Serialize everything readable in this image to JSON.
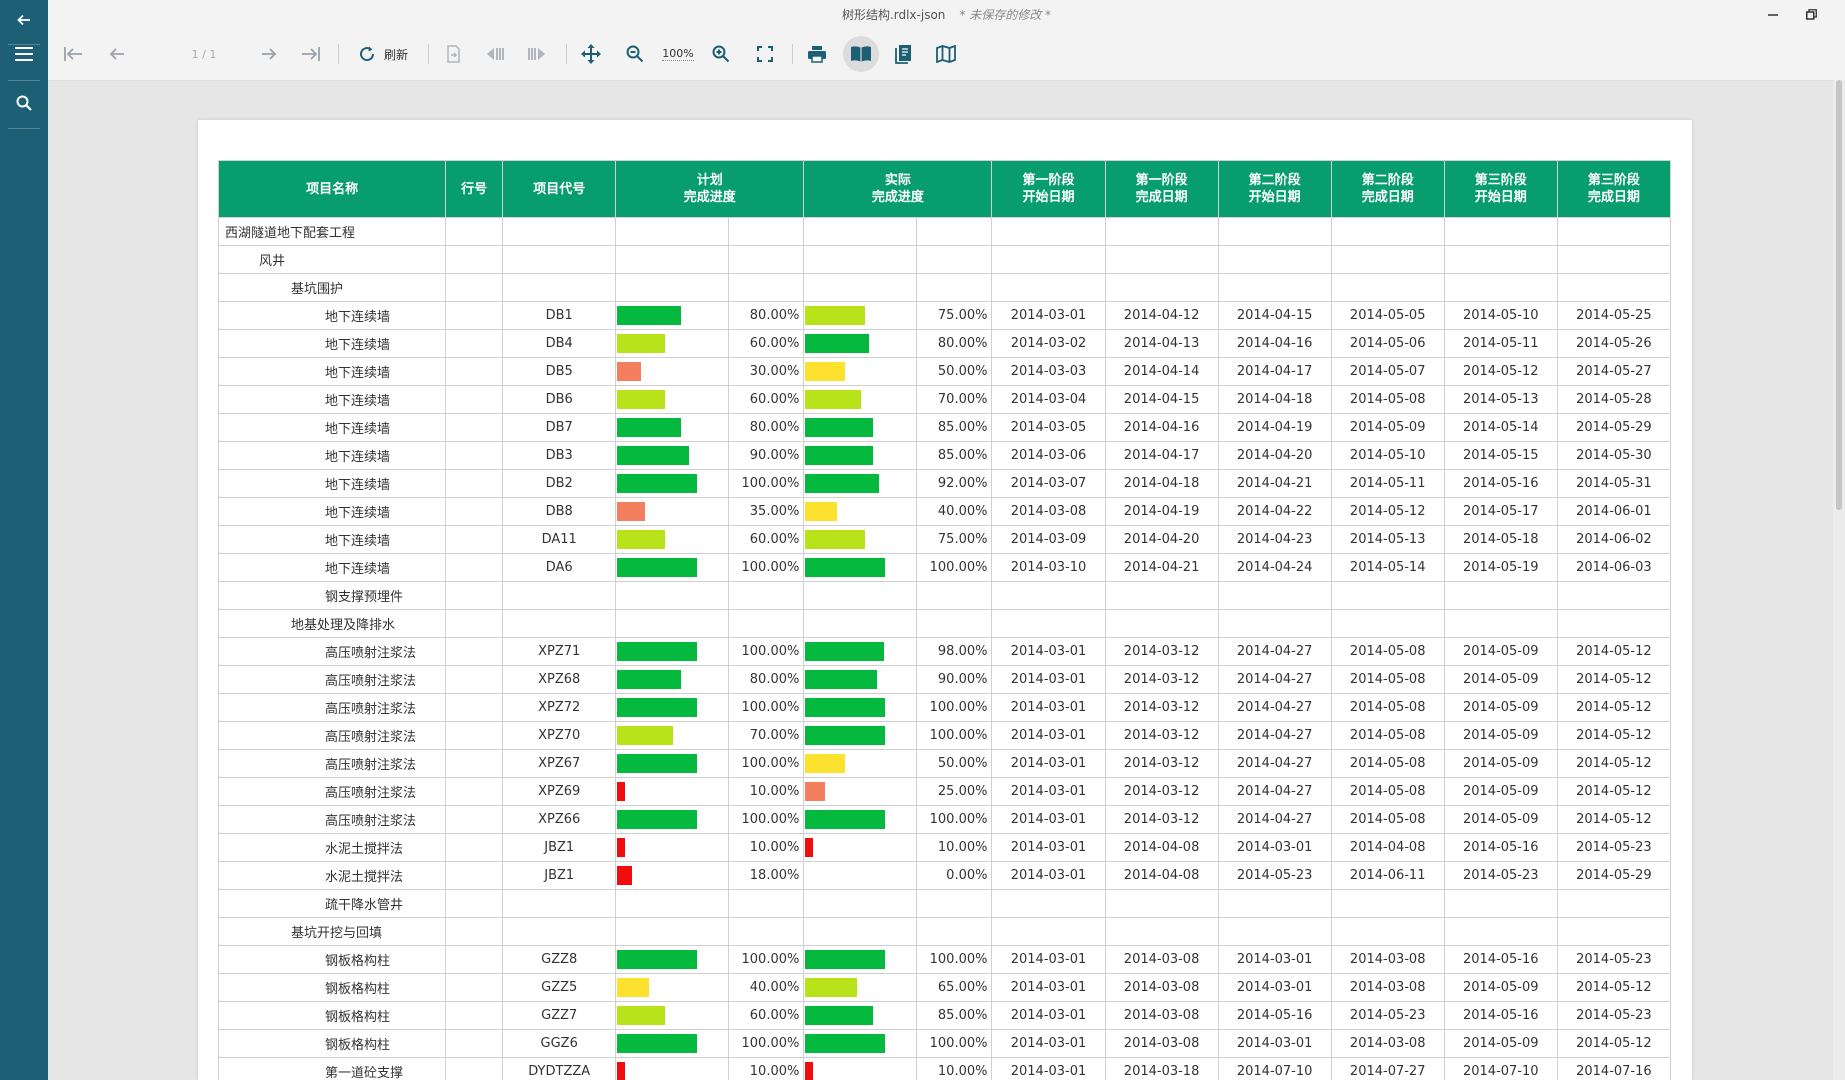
{
  "window": {
    "title": "树形结构.rdlx-json",
    "unsaved": "* 未保存的修改 *"
  },
  "toolbar": {
    "page_indicator": "1 / 1",
    "refresh_label": "刷新",
    "zoom_label": "100%"
  },
  "colors": {
    "sidebar": "#1d5f74",
    "header": "#079d6c",
    "bar_green": "#05b83e",
    "bar_lime": "#b8e31b",
    "bar_yellow": "#fde12f",
    "bar_orange": "#f37f5f",
    "bar_red": "#f10d0d"
  },
  "table": {
    "headers": [
      "项目名称",
      "行号",
      "项目代号",
      "计划\n完成进度",
      "",
      "实际\n完成进度",
      "",
      "第一阶段\n开始日期",
      "第一阶段\n完成日期",
      "第二阶段\n开始日期",
      "第二阶段\n完成日期",
      "第三阶段\n开始日期",
      "第三阶段\n完成日期"
    ],
    "rows": [
      {
        "name": "西湖隧道地下配套工程",
        "level": 0
      },
      {
        "name": "风井",
        "level": 1
      },
      {
        "name": "基坑围护",
        "level": 2
      },
      {
        "name": "地下连续墙",
        "level": 3,
        "code": "DB1",
        "plan": 80,
        "plan_text": "80.00%",
        "actual": 75,
        "actual_text": "75.00%",
        "dates": [
          "2014-03-01",
          "2014-04-12",
          "2014-04-15",
          "2014-05-05",
          "2014-05-10",
          "2014-05-25"
        ]
      },
      {
        "name": "地下连续墙",
        "level": 3,
        "code": "DB4",
        "plan": 60,
        "plan_text": "60.00%",
        "actual": 80,
        "actual_text": "80.00%",
        "dates": [
          "2014-03-02",
          "2014-04-13",
          "2014-04-16",
          "2014-05-06",
          "2014-05-11",
          "2014-05-26"
        ]
      },
      {
        "name": "地下连续墙",
        "level": 3,
        "code": "DB5",
        "plan": 30,
        "plan_text": "30.00%",
        "actual": 50,
        "actual_text": "50.00%",
        "dates": [
          "2014-03-03",
          "2014-04-14",
          "2014-04-17",
          "2014-05-07",
          "2014-05-12",
          "2014-05-27"
        ]
      },
      {
        "name": "地下连续墙",
        "level": 3,
        "code": "DB6",
        "plan": 60,
        "plan_text": "60.00%",
        "actual": 70,
        "actual_text": "70.00%",
        "dates": [
          "2014-03-04",
          "2014-04-15",
          "2014-04-18",
          "2014-05-08",
          "2014-05-13",
          "2014-05-28"
        ]
      },
      {
        "name": "地下连续墙",
        "level": 3,
        "code": "DB7",
        "plan": 80,
        "plan_text": "80.00%",
        "actual": 85,
        "actual_text": "85.00%",
        "dates": [
          "2014-03-05",
          "2014-04-16",
          "2014-04-19",
          "2014-05-09",
          "2014-05-14",
          "2014-05-29"
        ]
      },
      {
        "name": "地下连续墙",
        "level": 3,
        "code": "DB3",
        "plan": 90,
        "plan_text": "90.00%",
        "actual": 85,
        "actual_text": "85.00%",
        "dates": [
          "2014-03-06",
          "2014-04-17",
          "2014-04-20",
          "2014-05-10",
          "2014-05-15",
          "2014-05-30"
        ]
      },
      {
        "name": "地下连续墙",
        "level": 3,
        "code": "DB2",
        "plan": 100,
        "plan_text": "100.00%",
        "actual": 92,
        "actual_text": "92.00%",
        "dates": [
          "2014-03-07",
          "2014-04-18",
          "2014-04-21",
          "2014-05-11",
          "2014-05-16",
          "2014-05-31"
        ]
      },
      {
        "name": "地下连续墙",
        "level": 3,
        "code": "DB8",
        "plan": 35,
        "plan_text": "35.00%",
        "actual": 40,
        "actual_text": "40.00%",
        "dates": [
          "2014-03-08",
          "2014-04-19",
          "2014-04-22",
          "2014-05-12",
          "2014-05-17",
          "2014-06-01"
        ]
      },
      {
        "name": "地下连续墙",
        "level": 3,
        "code": "DA11",
        "plan": 60,
        "plan_text": "60.00%",
        "actual": 75,
        "actual_text": "75.00%",
        "dates": [
          "2014-03-09",
          "2014-04-20",
          "2014-04-23",
          "2014-05-13",
          "2014-05-18",
          "2014-06-02"
        ]
      },
      {
        "name": "地下连续墙",
        "level": 3,
        "code": "DA6",
        "plan": 100,
        "plan_text": "100.00%",
        "actual": 100,
        "actual_text": "100.00%",
        "dates": [
          "2014-03-10",
          "2014-04-21",
          "2014-04-24",
          "2014-05-14",
          "2014-05-19",
          "2014-06-03"
        ]
      },
      {
        "name": "钢支撑预埋件",
        "level": 3
      },
      {
        "name": "地基处理及降排水",
        "level": 2
      },
      {
        "name": "高压喷射注浆法",
        "level": 3,
        "code": "XPZ71",
        "plan": 100,
        "plan_text": "100.00%",
        "actual": 98,
        "actual_text": "98.00%",
        "dates": [
          "2014-03-01",
          "2014-03-12",
          "2014-04-27",
          "2014-05-08",
          "2014-05-09",
          "2014-05-12"
        ]
      },
      {
        "name": "高压喷射注浆法",
        "level": 3,
        "code": "XPZ68",
        "plan": 80,
        "plan_text": "80.00%",
        "actual": 90,
        "actual_text": "90.00%",
        "dates": [
          "2014-03-01",
          "2014-03-12",
          "2014-04-27",
          "2014-05-08",
          "2014-05-09",
          "2014-05-12"
        ]
      },
      {
        "name": "高压喷射注浆法",
        "level": 3,
        "code": "XPZ72",
        "plan": 100,
        "plan_text": "100.00%",
        "actual": 100,
        "actual_text": "100.00%",
        "dates": [
          "2014-03-01",
          "2014-03-12",
          "2014-04-27",
          "2014-05-08",
          "2014-05-09",
          "2014-05-12"
        ]
      },
      {
        "name": "高压喷射注浆法",
        "level": 3,
        "code": "XPZ70",
        "plan": 70,
        "plan_text": "70.00%",
        "actual": 100,
        "actual_text": "100.00%",
        "dates": [
          "2014-03-01",
          "2014-03-12",
          "2014-04-27",
          "2014-05-08",
          "2014-05-09",
          "2014-05-12"
        ]
      },
      {
        "name": "高压喷射注浆法",
        "level": 3,
        "code": "XPZ67",
        "plan": 100,
        "plan_text": "100.00%",
        "actual": 50,
        "actual_text": "50.00%",
        "dates": [
          "2014-03-01",
          "2014-03-12",
          "2014-04-27",
          "2014-05-08",
          "2014-05-09",
          "2014-05-12"
        ]
      },
      {
        "name": "高压喷射注浆法",
        "level": 3,
        "code": "XPZ69",
        "plan": 10,
        "plan_text": "10.00%",
        "actual": 25,
        "actual_text": "25.00%",
        "dates": [
          "2014-03-01",
          "2014-03-12",
          "2014-04-27",
          "2014-05-08",
          "2014-05-09",
          "2014-05-12"
        ]
      },
      {
        "name": "高压喷射注浆法",
        "level": 3,
        "code": "XPZ66",
        "plan": 100,
        "plan_text": "100.00%",
        "actual": 100,
        "actual_text": "100.00%",
        "dates": [
          "2014-03-01",
          "2014-03-12",
          "2014-04-27",
          "2014-05-08",
          "2014-05-09",
          "2014-05-12"
        ]
      },
      {
        "name": "水泥土搅拌法",
        "level": 3,
        "code": "JBZ1",
        "plan": 10,
        "plan_text": "10.00%",
        "actual": 10,
        "actual_text": "10.00%",
        "dates": [
          "2014-03-01",
          "2014-04-08",
          "2014-03-01",
          "2014-04-08",
          "2014-05-16",
          "2014-05-23"
        ]
      },
      {
        "name": "水泥土搅拌法",
        "level": 3,
        "code": "JBZ1",
        "plan": 18,
        "plan_text": "18.00%",
        "actual": 0,
        "actual_text": "0.00%",
        "dates": [
          "2014-03-01",
          "2014-04-08",
          "2014-05-23",
          "2014-06-11",
          "2014-05-23",
          "2014-05-29"
        ]
      },
      {
        "name": "疏干降水管井",
        "level": 3
      },
      {
        "name": "基坑开挖与回填",
        "level": 2
      },
      {
        "name": "钢板格构柱",
        "level": 3,
        "code": "GZZ8",
        "plan": 100,
        "plan_text": "100.00%",
        "actual": 100,
        "actual_text": "100.00%",
        "dates": [
          "2014-03-01",
          "2014-03-08",
          "2014-03-01",
          "2014-03-08",
          "2014-05-16",
          "2014-05-23"
        ]
      },
      {
        "name": "钢板格构柱",
        "level": 3,
        "code": "GZZ5",
        "plan": 40,
        "plan_text": "40.00%",
        "actual": 65,
        "actual_text": "65.00%",
        "dates": [
          "2014-03-01",
          "2014-03-08",
          "2014-03-01",
          "2014-03-08",
          "2014-05-09",
          "2014-05-12"
        ]
      },
      {
        "name": "钢板格构柱",
        "level": 3,
        "code": "GZZ7",
        "plan": 60,
        "plan_text": "60.00%",
        "actual": 85,
        "actual_text": "85.00%",
        "dates": [
          "2014-03-01",
          "2014-03-08",
          "2014-05-16",
          "2014-05-23",
          "2014-05-16",
          "2014-05-23"
        ]
      },
      {
        "name": "钢板格构柱",
        "level": 3,
        "code": "GGZ6",
        "plan": 100,
        "plan_text": "100.00%",
        "actual": 100,
        "actual_text": "100.00%",
        "dates": [
          "2014-03-01",
          "2014-03-08",
          "2014-03-01",
          "2014-03-08",
          "2014-05-09",
          "2014-05-12"
        ]
      },
      {
        "name": "第一道砼支撑",
        "level": 3,
        "code": "DYDTZZA",
        "plan": 10,
        "plan_text": "10.00%",
        "actual": 10,
        "actual_text": "10.00%",
        "dates": [
          "2014-03-01",
          "2014-03-18",
          "2014-07-10",
          "2014-07-27",
          "2014-07-10",
          "2014-07-16"
        ]
      }
    ]
  }
}
